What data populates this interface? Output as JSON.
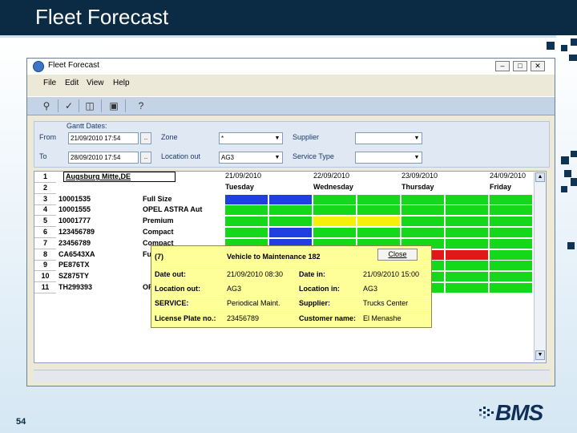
{
  "slide": {
    "title": "Fleet Forecast",
    "page_number": "54",
    "logo_text": "BMS"
  },
  "window": {
    "title": "Fleet Forecast",
    "buttons": {
      "minimize": "–",
      "maximize": "□",
      "close": "✕"
    }
  },
  "menu": [
    "File",
    "Edit",
    "View",
    "Help"
  ],
  "toolbar": {
    "icons": [
      "search-icon",
      "wrench-icon",
      "export-icon",
      "screen-icon",
      "help-icon"
    ]
  },
  "filters": {
    "gantt_dates_label": "Gantt Dates:",
    "from_label": "From",
    "from_value": "21/09/2010 17:54",
    "to_label": "To",
    "to_value": "28/09/2010 17:54",
    "ellipsis": "..",
    "zone_label": "Zone",
    "zone_value": "*",
    "location_out_label": "Location out",
    "location_out_value": "AG3",
    "supplier_label": "Supplier",
    "supplier_value": "",
    "service_type_label": "Service Type",
    "service_type_value": ""
  },
  "grid": {
    "location_header": "Augsburg Mitte,DE",
    "dates": [
      "21/09/2010",
      "22/09/2010",
      "23/09/2010",
      "24/09/2010"
    ],
    "days": [
      "Tuesday",
      "Wednesday",
      "Thursday",
      "Friday"
    ],
    "rows": [
      {
        "num": "1",
        "id": "",
        "cls": ""
      },
      {
        "num": "2",
        "id": "",
        "cls": ""
      },
      {
        "num": "3",
        "id": "10001535",
        "cls": "Full Size"
      },
      {
        "num": "4",
        "id": "10001555",
        "cls": "OPEL ASTRA Aut"
      },
      {
        "num": "5",
        "id": "10001777",
        "cls": "Premium"
      },
      {
        "num": "6",
        "id": "123456789",
        "cls": "Compact"
      },
      {
        "num": "7",
        "id": "23456789",
        "cls": "Compact"
      },
      {
        "num": "8",
        "id": "CA6543XA",
        "cls": "Ful"
      },
      {
        "num": "9",
        "id": "PE876TX",
        "cls": ""
      },
      {
        "num": "10",
        "id": "SZ875TY",
        "cls": ""
      },
      {
        "num": "11",
        "id": "TH299393",
        "cls": "OP"
      }
    ],
    "legend_colors": {
      "available": "#15d81a",
      "booked": "#1f3fe0",
      "reserved": "#f5f007",
      "maintenance": "#e01818"
    }
  },
  "popup": {
    "count": "(7)",
    "title": "Vehicle to Maintenance 182",
    "close_label": "Close",
    "date_out_label": "Date out:",
    "date_out_value": "21/09/2010 08:30",
    "date_in_label": "Date in:",
    "date_in_value": "21/09/2010 15:00",
    "location_out_label": "Location out:",
    "location_out_value": "AG3",
    "location_in_label": "Location in:",
    "location_in_value": "AG3",
    "service_label": "SERVICE:",
    "service_value": "Periodical Maint.",
    "supplier_label": "Supplier:",
    "supplier_value": "Trucks Center",
    "plate_label": "License Plate no.:",
    "plate_value": "23456789",
    "customer_label": "Customer name:",
    "customer_value": "El Menashe"
  }
}
